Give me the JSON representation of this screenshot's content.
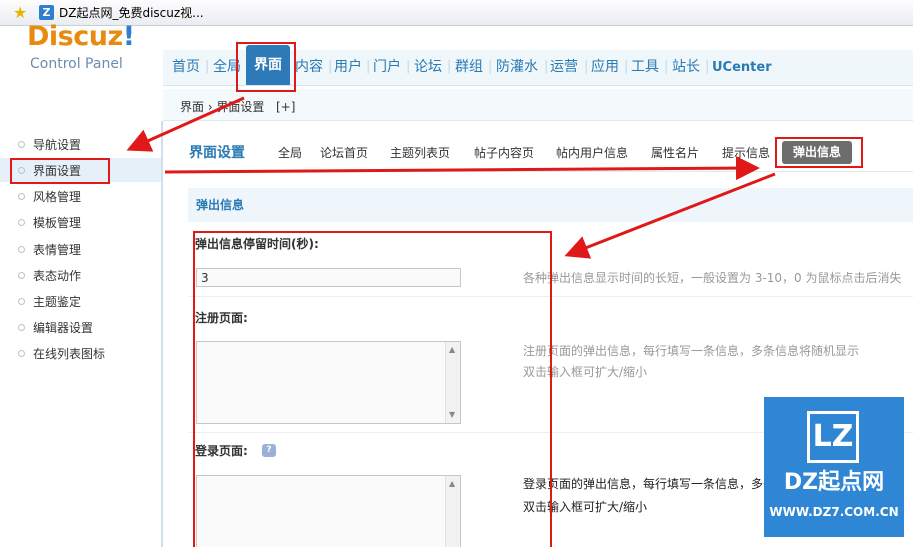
{
  "browser": {
    "title": "DZ起点网_免费discuz视..."
  },
  "logo": {
    "word": "Discuz",
    "bang": "!",
    "subtitle": "Control Panel"
  },
  "nav": {
    "items": [
      "首页",
      "全局",
      "界面",
      "内容",
      "用户",
      "门户",
      "论坛",
      "群组",
      "防灌水",
      "运营",
      "应用",
      "工具",
      "站长",
      "UCenter"
    ],
    "active": "界面"
  },
  "breadcrumb": {
    "text": "界面 › 界面设置",
    "plus": "[+]"
  },
  "sidebar": {
    "items": [
      "导航设置",
      "界面设置",
      "风格管理",
      "模板管理",
      "表情管理",
      "表态动作",
      "主题鉴定",
      "编辑器设置",
      "在线列表图标"
    ],
    "active": "界面设置"
  },
  "content": {
    "title": "界面设置",
    "tabs": [
      "全局",
      "论坛首页",
      "主题列表页",
      "帖子内容页",
      "帖内用户信息",
      "属性名片",
      "提示信息",
      "弹出信息"
    ],
    "active_tab": "弹出信息"
  },
  "section": {
    "title": "弹出信息",
    "fields": [
      {
        "label": "弹出信息停留时间(秒):",
        "value": "3",
        "hint": "各种弹出信息显示时间的长短，一般设置为 3-10，0 为鼠标点击后消失"
      },
      {
        "label": "注册页面:",
        "hint1": "注册页面的弹出信息，每行填写一条信息，多条信息将随机显示",
        "hint2": "双击输入框可扩大/缩小"
      },
      {
        "label": "登录页面:",
        "help": "?",
        "hint1": "登录页面的弹出信息，每行填写一条信息，多条",
        "hint2": "双击输入框可扩大/缩小"
      }
    ]
  },
  "watermark": {
    "badge": "LZ",
    "name": "DZ起点网",
    "url": "WWW.DZ7.COM.CN"
  },
  "colors": {
    "accent": "#2a7ab3",
    "nav_active_bg": "#2e7ab8",
    "annotation": "#e01818",
    "logo_orange": "#e98a10"
  }
}
